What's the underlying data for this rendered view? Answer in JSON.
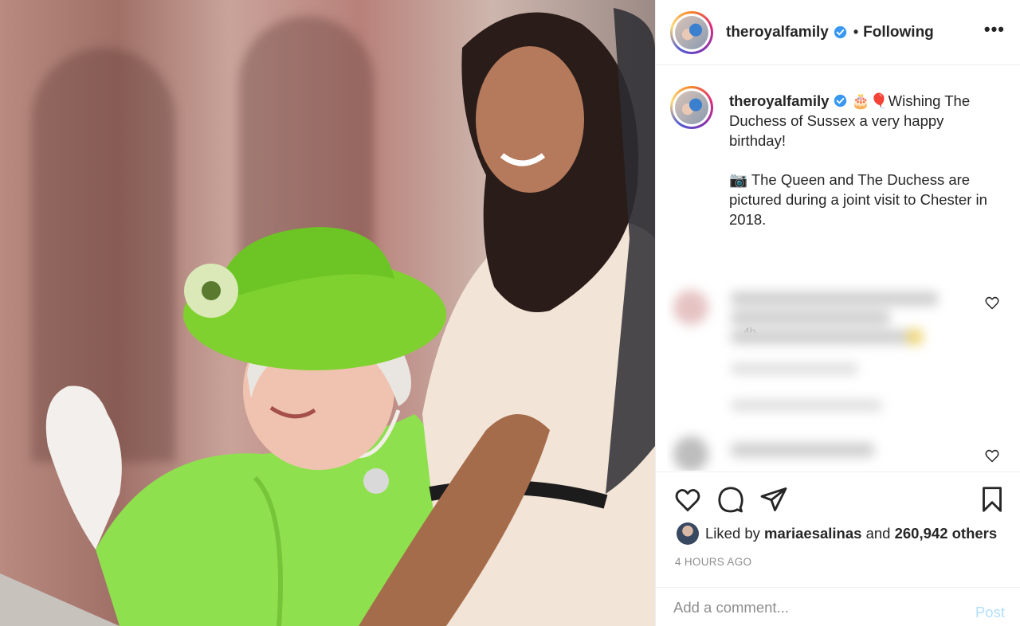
{
  "post": {
    "username": "theroyalfamily",
    "follow_state": "Following",
    "more_icon": "more-options-icon"
  },
  "caption": {
    "username": "theroyalfamily",
    "line1": "🎂🎈Wishing The Duchess of Sussex a very happy birthday!",
    "line2": "📷 The Queen and The Duchess are pictured during a joint visit to Chester in 2018.",
    "time": "4h"
  },
  "likes": {
    "prefix": "Liked by",
    "user": "mariaesalinas",
    "joiner": "and",
    "count": "260,942 others"
  },
  "posted_ago": "4 HOURS AGO",
  "comment": {
    "placeholder": "Add a comment...",
    "post_label": "Post"
  },
  "colors": {
    "verified": "#3897f0",
    "post_button_disabled": "#b2dffc",
    "secondary_text": "#8e8e8e"
  }
}
